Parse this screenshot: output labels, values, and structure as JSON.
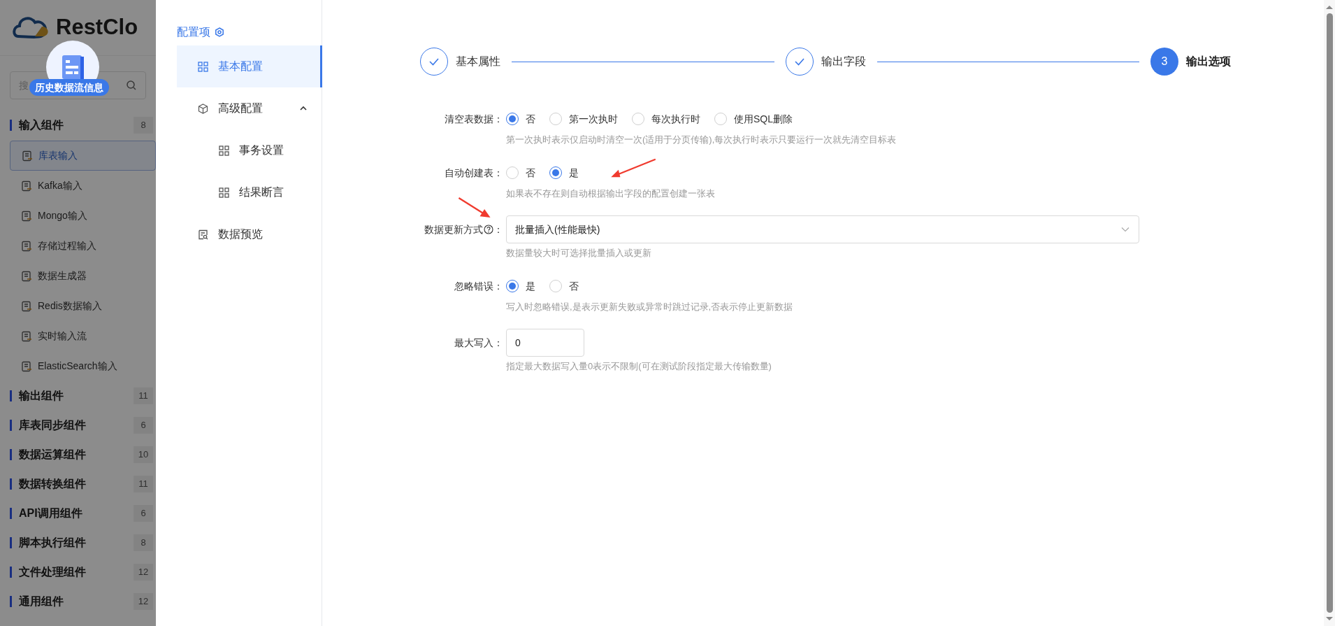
{
  "background_page": {
    "logo_text": "RestClo",
    "search": {
      "placeholder": "搜"
    },
    "floating_badge": "历史数据流信息",
    "groups": [
      {
        "title": "输入组件",
        "count": "8",
        "items": [
          {
            "label": "库表输入",
            "selected": true
          },
          {
            "label": "Kafka输入",
            "selected": false
          },
          {
            "label": "Mongo输入",
            "selected": false
          },
          {
            "label": "存储过程输入",
            "selected": false
          },
          {
            "label": "数据生成器",
            "selected": false
          },
          {
            "label": "Redis数据输入",
            "selected": false
          },
          {
            "label": "实时输入流",
            "selected": false
          },
          {
            "label": "ElasticSearch输入",
            "selected": false
          }
        ]
      },
      {
        "title": "输出组件",
        "count": "11"
      },
      {
        "title": "库表同步组件",
        "count": "6"
      },
      {
        "title": "数据运算组件",
        "count": "10"
      },
      {
        "title": "数据转换组件",
        "count": "11"
      },
      {
        "title": "API调用组件",
        "count": "6"
      },
      {
        "title": "脚本执行组件",
        "count": "8"
      },
      {
        "title": "文件处理组件",
        "count": "12"
      },
      {
        "title": "通用组件",
        "count": "12"
      }
    ]
  },
  "config_menu": {
    "title": "配置项",
    "items": [
      {
        "label": "基本配置",
        "selected": true
      },
      {
        "label": "高级配置",
        "selected": false,
        "expanded": true,
        "children": [
          {
            "label": "事务设置",
            "selected": false
          },
          {
            "label": "结果断言",
            "selected": false
          }
        ]
      },
      {
        "label": "数据预览",
        "selected": false
      }
    ]
  },
  "steps": [
    {
      "label": "基本属性",
      "done": true,
      "selected": false
    },
    {
      "label": "输出字段",
      "done": true,
      "selected": false
    },
    {
      "label": "输出选项",
      "number": "3",
      "done": false,
      "selected": true
    }
  ],
  "form": [
    {
      "kind": "radio",
      "label": "清空表数据",
      "colon": "：",
      "options": [
        {
          "label": "否",
          "selected": true
        },
        {
          "label": "第一次执时",
          "selected": false
        },
        {
          "label": "每次执行时",
          "selected": false
        },
        {
          "label": "使用SQL删除",
          "selected": false
        }
      ],
      "hint": "第一次执时表示仅启动时清空一次(适用于分页传输),每次执行时表示只要运行一次就先清空目标表"
    },
    {
      "kind": "radio",
      "label": "自动创建表",
      "colon": "：",
      "options": [
        {
          "label": "否",
          "selected": false
        },
        {
          "label": "是",
          "selected": true
        }
      ],
      "hint": "如果表不存在则自动根据输出字段的配置创建一张表"
    },
    {
      "kind": "select",
      "label": "数据更新方式",
      "colon": "：",
      "help": true,
      "value": "批量插入(性能最快)",
      "hint": "数据量较大时可选择批量插入或更新"
    },
    {
      "kind": "radio",
      "label": "忽略错误",
      "colon": "：",
      "options": [
        {
          "label": "是",
          "selected": true
        },
        {
          "label": "否",
          "selected": false
        }
      ],
      "hint": "写入时忽略错误,是表示更新失败或异常时跳过记录,否表示停止更新数据"
    },
    {
      "kind": "input",
      "label": "最大写入",
      "colon": "：",
      "value": "0",
      "hint": "指定最大数据写入量0表示不限制(可在测试阶段指定最大传输数量)"
    }
  ]
}
